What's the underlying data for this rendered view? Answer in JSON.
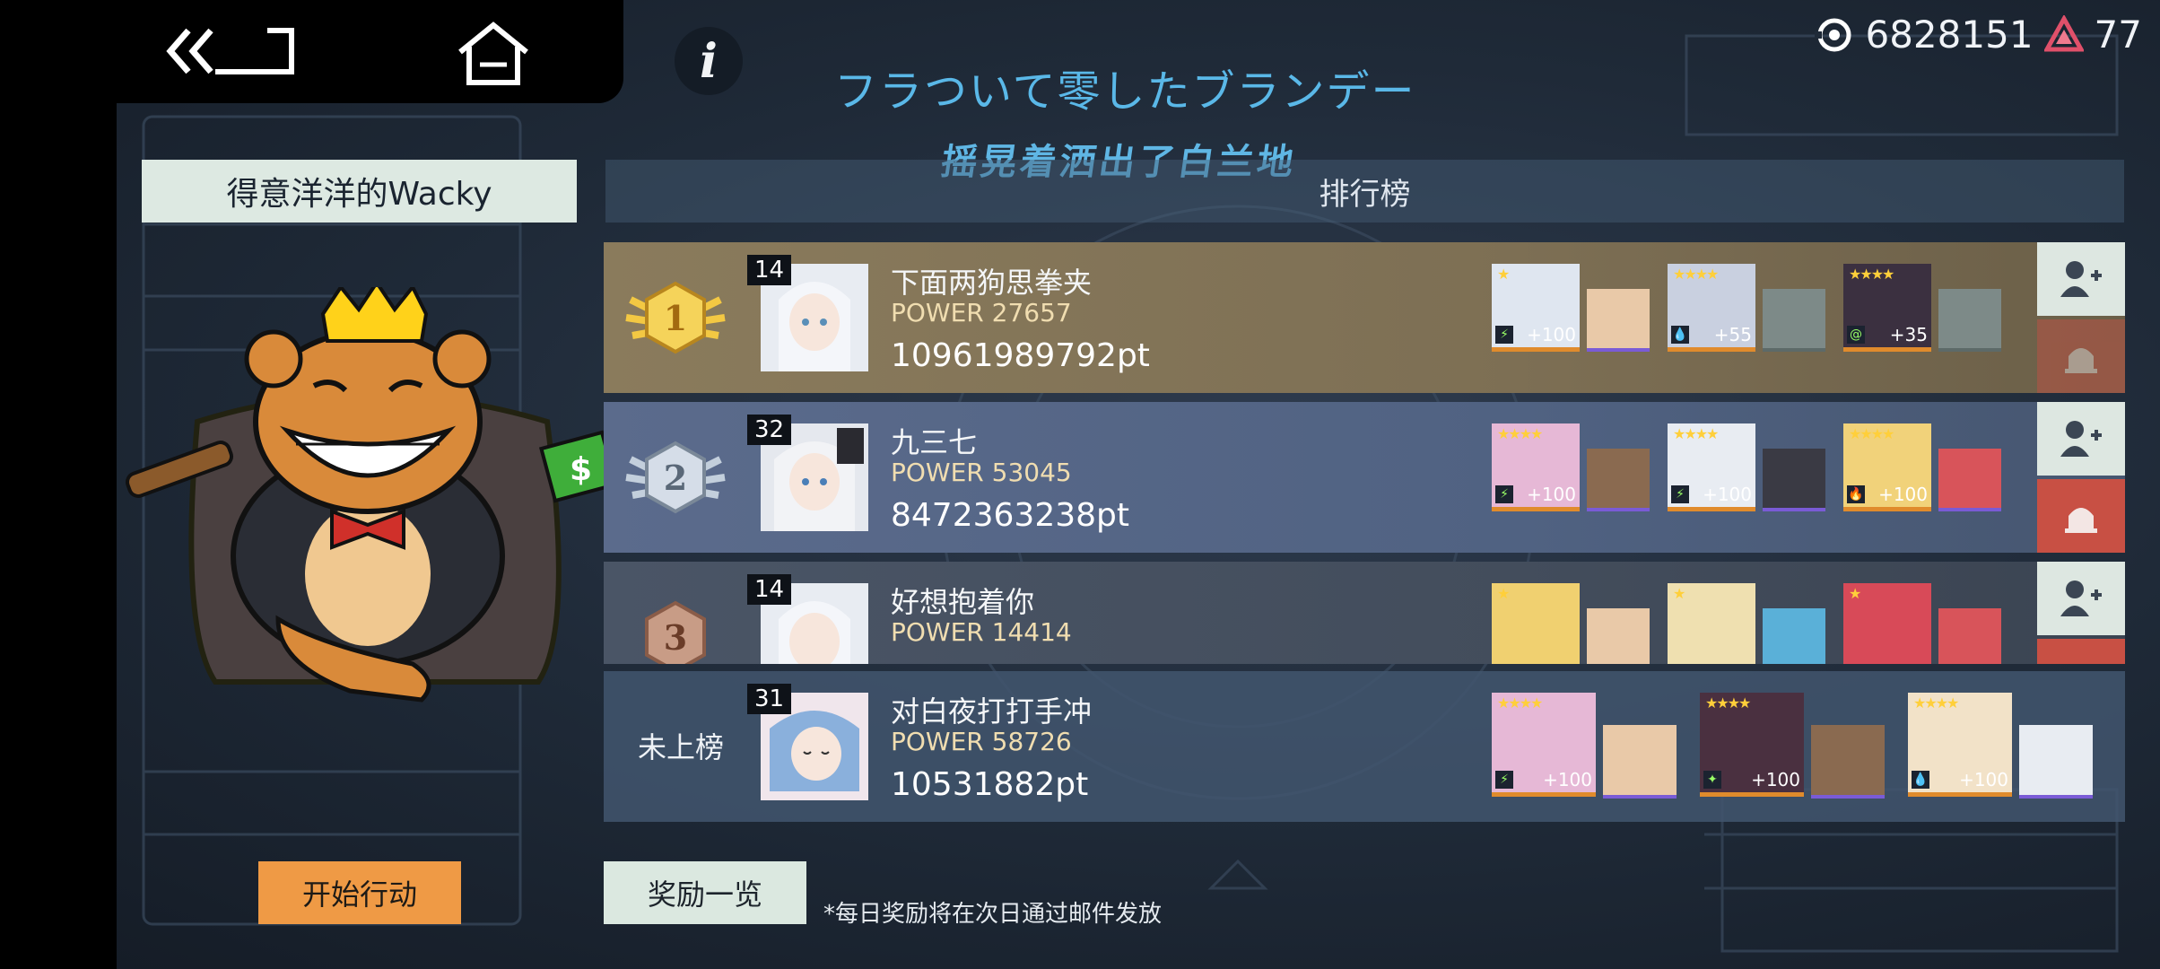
{
  "currency": {
    "gems": "6828151",
    "stamina": "77"
  },
  "header": {
    "title": "フラついて零したブランデー",
    "subtitle": "摇晃着洒出了白兰地"
  },
  "player": {
    "name": "得意洋洋的Wacky"
  },
  "leaderboard": {
    "title": "排行榜",
    "rows": [
      {
        "rank": 1,
        "level": "14",
        "name": "下面两狗思拳夹",
        "power": "POWER 27657",
        "points": "10961989792pt"
      },
      {
        "rank": 2,
        "level": "32",
        "name": "九三七",
        "power": "POWER 53045",
        "points": "8472363238pt"
      },
      {
        "rank": 3,
        "level": "14",
        "name": "好想抱着你",
        "power": "POWER 14414",
        "points": ""
      }
    ],
    "my_row": {
      "rank_label": "未上榜",
      "level": "31",
      "name": "对白夜打打手冲",
      "power": "POWER 58726",
      "points": "10531882pt"
    }
  },
  "buttons": {
    "start": "开始行动",
    "rewards": "奖励一览"
  },
  "note": "*每日奖励将在次日通过邮件发放",
  "colors": {
    "accent_blue": "#5ab8e8",
    "gold_row": "#8a7b5c",
    "silver_row": "#5b6b8c",
    "bronze_row": "#4a5566",
    "start_button": "#ef9a45",
    "report_red": "#c85044"
  }
}
